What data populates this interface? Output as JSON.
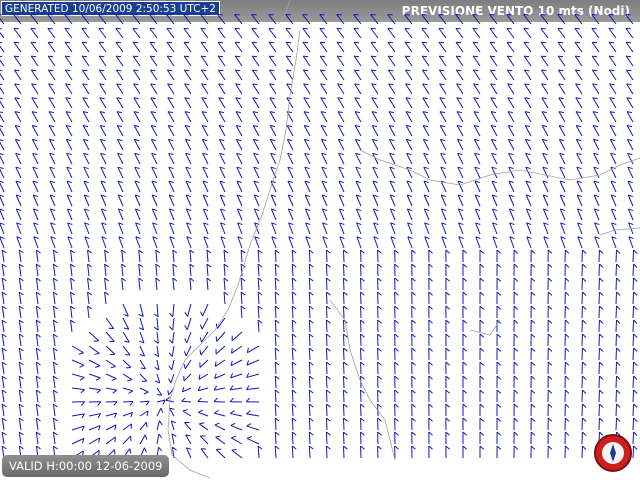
{
  "header": {
    "generated_label": "GENERATED 10/06/2009 2:50:53 UTC+2",
    "title": "PREVISIONE VENTO 10 mts (Nodi)"
  },
  "footer": {
    "valid_label": "VALID H:00:00  12-06-2009"
  },
  "colors": {
    "wind_barb": "#1515b8",
    "coastline": "#a0a0a0",
    "header_band": "#8c8c8c",
    "generated_bg": "#1b3f8f",
    "logo_red": "#cc1f1f"
  },
  "icons": [
    "logo-icon"
  ]
}
